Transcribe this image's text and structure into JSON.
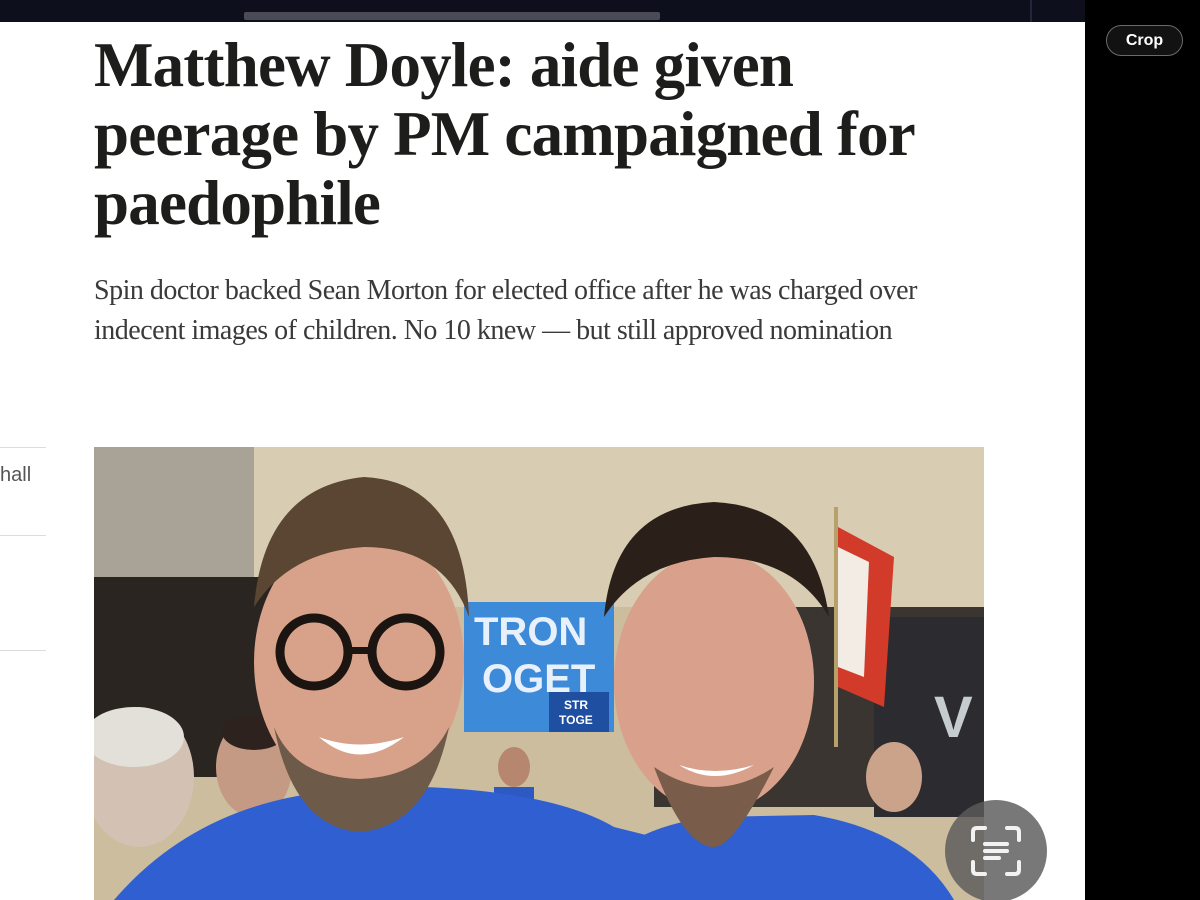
{
  "toolbar": {
    "crop_label": "Crop"
  },
  "article": {
    "headline": "Matthew Doyle: aide given peerage by PM campaigned for paedophile",
    "standfirst": "Spin doctor backed Sean Morton for elected office after he was charged over indecent images of children. No 10 knew — but still approved nomination"
  },
  "sidebar": {
    "partial_link_text": "hall"
  },
  "photo": {
    "sign_text_line1": "TRON",
    "sign_text_line2": "OGET",
    "sign_small_line1": "STR",
    "sign_small_line2": "TOGE",
    "right_letter": "V"
  },
  "colors": {
    "page_bg": "#ffffff",
    "headline": "#1d1d1b",
    "standfirst": "#3a3a3a",
    "shirt_blue": "#2f5fd0",
    "sign_blue": "#3d8ad8"
  },
  "icons": {
    "lens_button": "text-scan-icon"
  }
}
